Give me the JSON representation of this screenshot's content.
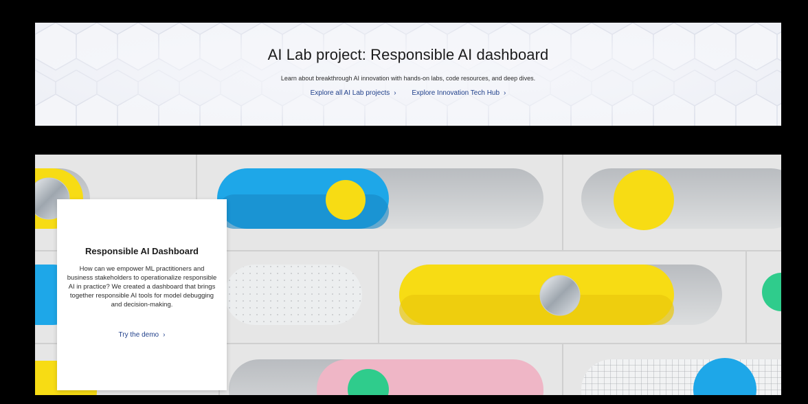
{
  "hero": {
    "title": "AI Lab project: Responsible AI dashboard",
    "subtitle": "Learn about breakthrough AI innovation with hands-on labs, code resources, and deep dives.",
    "links": [
      {
        "label": "Explore all AI Lab projects",
        "icon": "chevron-right-icon"
      },
      {
        "label": "Explore Innovation Tech Hub",
        "icon": "chevron-right-icon"
      }
    ]
  },
  "card": {
    "title": "Responsible AI Dashboard",
    "body": "How can we empower ML practitioners and business stakeholders to operationalize responsible AI in practice? We created a dashboard that brings together responsible AI tools for model debugging and decision-making.",
    "link_label": "Try the demo",
    "link_icon": "chevron-right-icon"
  },
  "colors": {
    "link": "#1f3f8a",
    "hero_bg": "#eef0f6",
    "yellow": "#f7dc14",
    "blue": "#1ea7e8",
    "pink": "#efb6c6",
    "green": "#2fcc8c"
  }
}
